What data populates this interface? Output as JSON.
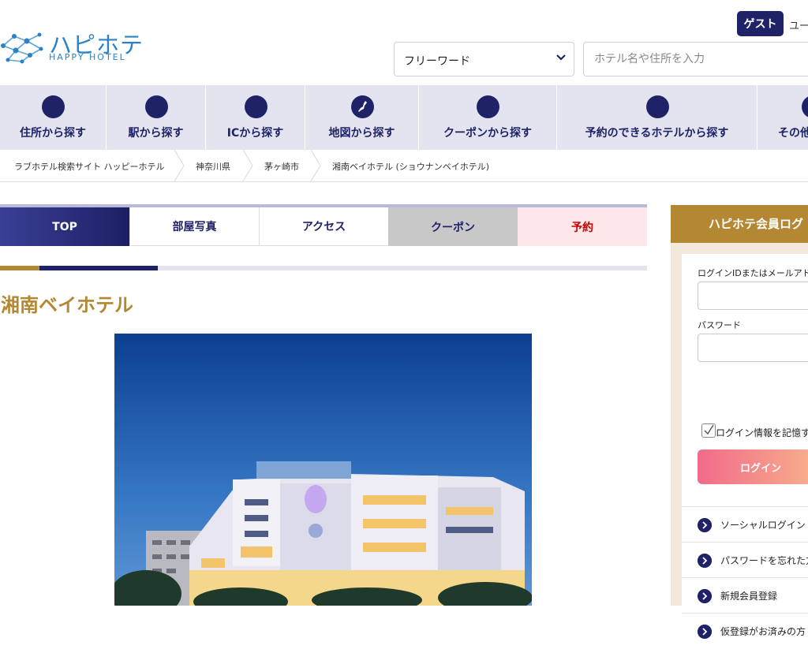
{
  "header": {
    "logo_title": "ハピホテ",
    "logo_subtitle": "HAPPY HOTEL",
    "guest_label": "ゲスト",
    "user_text": "ユー"
  },
  "search": {
    "freeword_label": "フリーワード",
    "placeholder": "ホテル名や住所を入力"
  },
  "nav": {
    "items": [
      {
        "label": "住所から探す"
      },
      {
        "label": "駅から探す"
      },
      {
        "label": "ICから探す"
      },
      {
        "label": "地図から探す"
      },
      {
        "label": "クーポンから探す"
      },
      {
        "label": "予約のできるホテルから探す"
      },
      {
        "label": "その他"
      }
    ]
  },
  "breadcrumb": {
    "items": [
      "ラブホテル検索サイト ハッピーホテル",
      "神奈川県",
      "茅ヶ崎市",
      "湘南ベイホテル (ショウナンベイホテル)"
    ]
  },
  "tabs": {
    "top": "TOP",
    "photos": "部屋写真",
    "access": "アクセス",
    "coupon": "クーポン",
    "reserve": "予約"
  },
  "hotel": {
    "title": "湘南ベイホテル"
  },
  "login": {
    "header": "ハピホテ会員ログ",
    "id_label": "ログインIDまたはメールアドレ",
    "password_label": "パスワード",
    "remember_label": "ログイン情報を記憶す",
    "button_label": "ログイン",
    "links": [
      {
        "label": "ソーシャルログイン"
      },
      {
        "label": "パスワードを忘れた方"
      },
      {
        "label": "新規会員登録"
      },
      {
        "label": "仮登録がお済みの方"
      }
    ]
  },
  "colors": {
    "navy": "#1f2266",
    "gold": "#b48732",
    "nav_bg": "#e3e4f0",
    "reserve_red": "#c80000"
  }
}
